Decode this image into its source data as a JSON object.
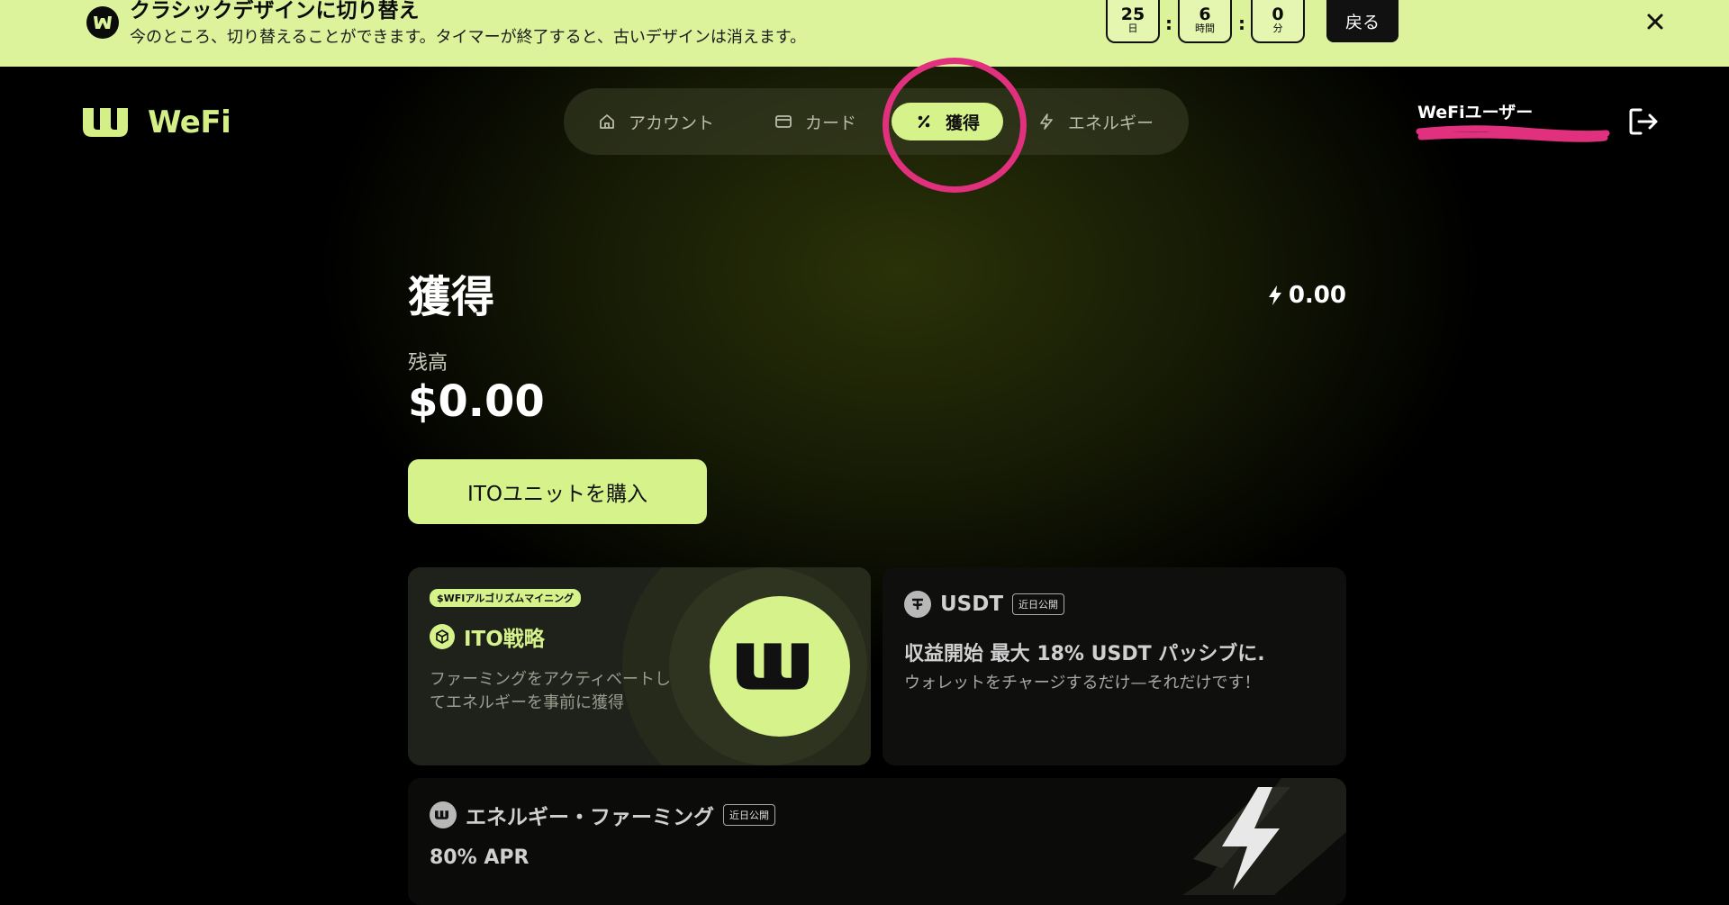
{
  "banner": {
    "title": "クラシックデザインに切り替え",
    "description": "今のところ、切り替えることができます。タイマーが終了すると、古いデザインは消えます。",
    "timer": [
      {
        "value": "25",
        "unit": "日"
      },
      {
        "value": "6",
        "unit": "時間"
      },
      {
        "value": "0",
        "unit": "分"
      }
    ],
    "timer_separator": ":",
    "back_label": "戻る"
  },
  "brand": {
    "name": "WeFi"
  },
  "nav": {
    "items": [
      {
        "label": "アカウント",
        "icon": "home-icon"
      },
      {
        "label": "カード",
        "icon": "card-icon"
      },
      {
        "label": "獲得",
        "icon": "percent-icon",
        "active": true
      },
      {
        "label": "エネルギー",
        "icon": "bolt-icon"
      }
    ]
  },
  "user": {
    "name": "WeFiユーザー"
  },
  "page": {
    "title": "獲得",
    "energy": "0.00",
    "balance_label": "残高",
    "balance_value": "$0.00",
    "buy_label": "ITOユニットを購入"
  },
  "cards": {
    "ito": {
      "tag": "$WFIアルゴリズムマイニング",
      "title": "ITO戦略",
      "description": "ファーミングをアクティベートしてエネルギーを事前に獲得"
    },
    "usdt": {
      "name": "USDT",
      "tag": "近日公開",
      "headline": "収益開始 最大 18% USDT パッシブに.",
      "sub": "ウォレットをチャージするだけ—それだけです！"
    },
    "farming": {
      "name": "エネルギー・ファーミング",
      "tag": "近日公開",
      "apr": "80% APR"
    }
  },
  "colors": {
    "accent": "#d6f28b",
    "banner_bg": "#dcf39b",
    "annotation": "#e0307e"
  }
}
